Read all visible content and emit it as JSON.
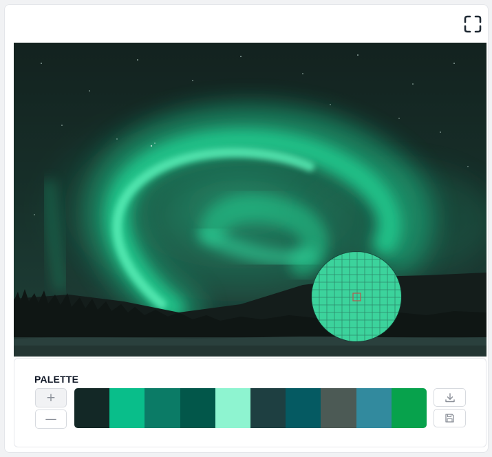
{
  "toolbar": {
    "fullscreen_icon": "fullscreen-icon"
  },
  "image": {
    "subject": "aurora-photo"
  },
  "loupe": {
    "icon": "magnifier-loupe",
    "sample_color": "#3FD9A1",
    "grid_color": "#2a7d62",
    "selected_cell_color": "#b8584c"
  },
  "palette": {
    "title": "PALETTE",
    "add_icon": "plus-icon",
    "remove_icon": "minus-icon",
    "add_label": "+",
    "remove_label": "—",
    "download_icon": "download-icon",
    "save_icon": "save-icon",
    "colors": [
      "#132826",
      "#09BE8A",
      "#0B7B66",
      "#02574A",
      "#8EF4D0",
      "#1E3F41",
      "#055A62",
      "#4C5A55",
      "#328A9E",
      "#07A24C"
    ]
  }
}
